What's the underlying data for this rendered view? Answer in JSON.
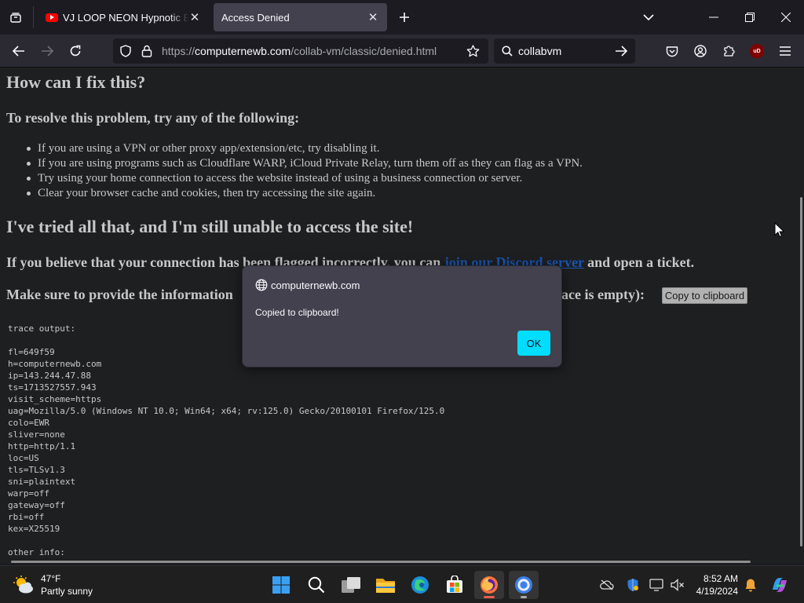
{
  "browser": {
    "tabs": [
      {
        "title": "VJ LOOP NEON Hypnotic Blue Geometric",
        "active": false
      },
      {
        "title": "Access Denied",
        "active": true
      }
    ],
    "url": {
      "protocol": "https://",
      "host": "computernewb.com",
      "path": "/collab-vm/classic/denied.html"
    },
    "search_query": "collabvm",
    "ublock_badge": "uD"
  },
  "page": {
    "heading_fix": "How can I fix this?",
    "heading_resolve": "To resolve this problem, try any of the following:",
    "tips": [
      "If you are using a VPN or other proxy app/extension/etc, try disabling it.",
      "If you are using programs such as Cloudflare WARP, iCloud Private Relay, turn them off as they can flag as a VPN.",
      "Try using your home connection to access the website instead of using a business connection or server.",
      "Clear your browser cache and cookies, then try accessing the site again."
    ],
    "heading_tried": "I've tried all that, and I'm still unable to access the site!",
    "discord_before": "If you believe that your connection has been flagged incorrectly, you can ",
    "discord_link": "join our Discord server",
    "discord_after": " and open a ticket.",
    "provide_visible": "Make sure to provide the information",
    "provide_end": "pace is empty):",
    "copy_button": "Copy to clipboard",
    "trace_lines": [
      "trace output:",
      "",
      "fl=649f59",
      "h=computernewb.com",
      "ip=143.244.47.88",
      "ts=1713527557.943",
      "visit_scheme=https",
      "uag=Mozilla/5.0 (Windows NT 10.0; Win64; x64; rv:125.0) Gecko/20100101 Firefox/125.0",
      "colo=EWR",
      "sliver=none",
      "http=http/1.1",
      "loc=US",
      "tls=TLSv1.3",
      "sni=plaintext",
      "warp=off",
      "gateway=off",
      "rbi=off",
      "kex=X25519",
      "",
      "other info:"
    ]
  },
  "dialog": {
    "origin": "computernewb.com",
    "message": "Copied to clipboard!",
    "ok_label": "OK"
  },
  "taskbar": {
    "weather_temp": "47°F",
    "weather_desc": "Partly sunny",
    "time": "8:52 AM",
    "date": "4/19/2024"
  },
  "colors": {
    "link": "#1a55b0",
    "dialog_ok": "#00ddff",
    "dialog_bg": "#42414d"
  }
}
